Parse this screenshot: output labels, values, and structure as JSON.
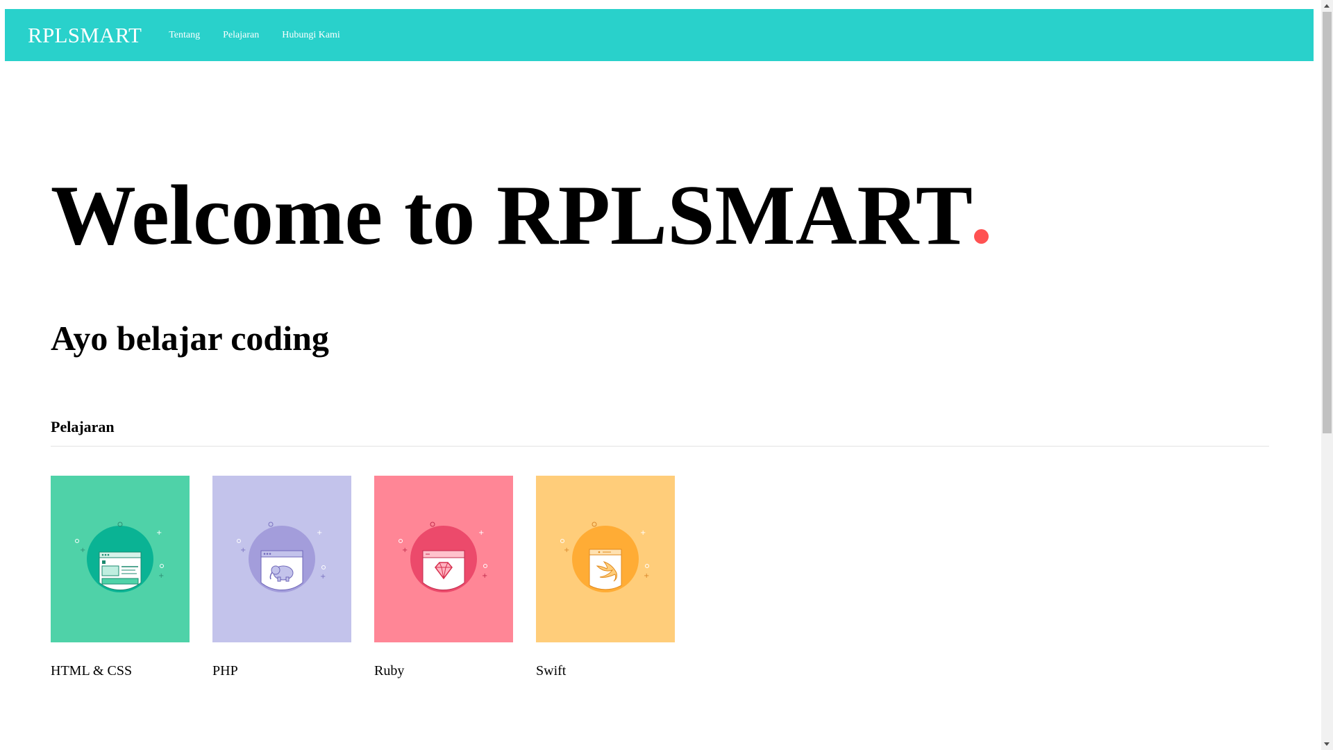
{
  "navbar": {
    "brand": "RPLSMART",
    "links": [
      {
        "label": "Tentang"
      },
      {
        "label": "Pelajaran"
      },
      {
        "label": "Hubungi Kami"
      }
    ],
    "background_color": "#29d1cb"
  },
  "hero": {
    "title": "Welcome to RPLSMART",
    "dot_color": "#ff5252"
  },
  "subtitle": "Ayo belajar coding",
  "section": {
    "title": "Pelajaran"
  },
  "courses": [
    {
      "label": "HTML & CSS",
      "bg_color": "#4fd2a8",
      "circle_color": "#0ab394",
      "icon": "html-css-window-icon"
    },
    {
      "label": "PHP",
      "bg_color": "#c3c3eb",
      "circle_color": "#a39ddb",
      "icon": "php-elephant-icon"
    },
    {
      "label": "Ruby",
      "bg_color": "#ff8696",
      "circle_color": "#ec4a6b",
      "icon": "ruby-gem-icon"
    },
    {
      "label": "Swift",
      "bg_color": "#ffcd7a",
      "circle_color": "#ffac35",
      "icon": "swift-bird-icon"
    }
  ]
}
